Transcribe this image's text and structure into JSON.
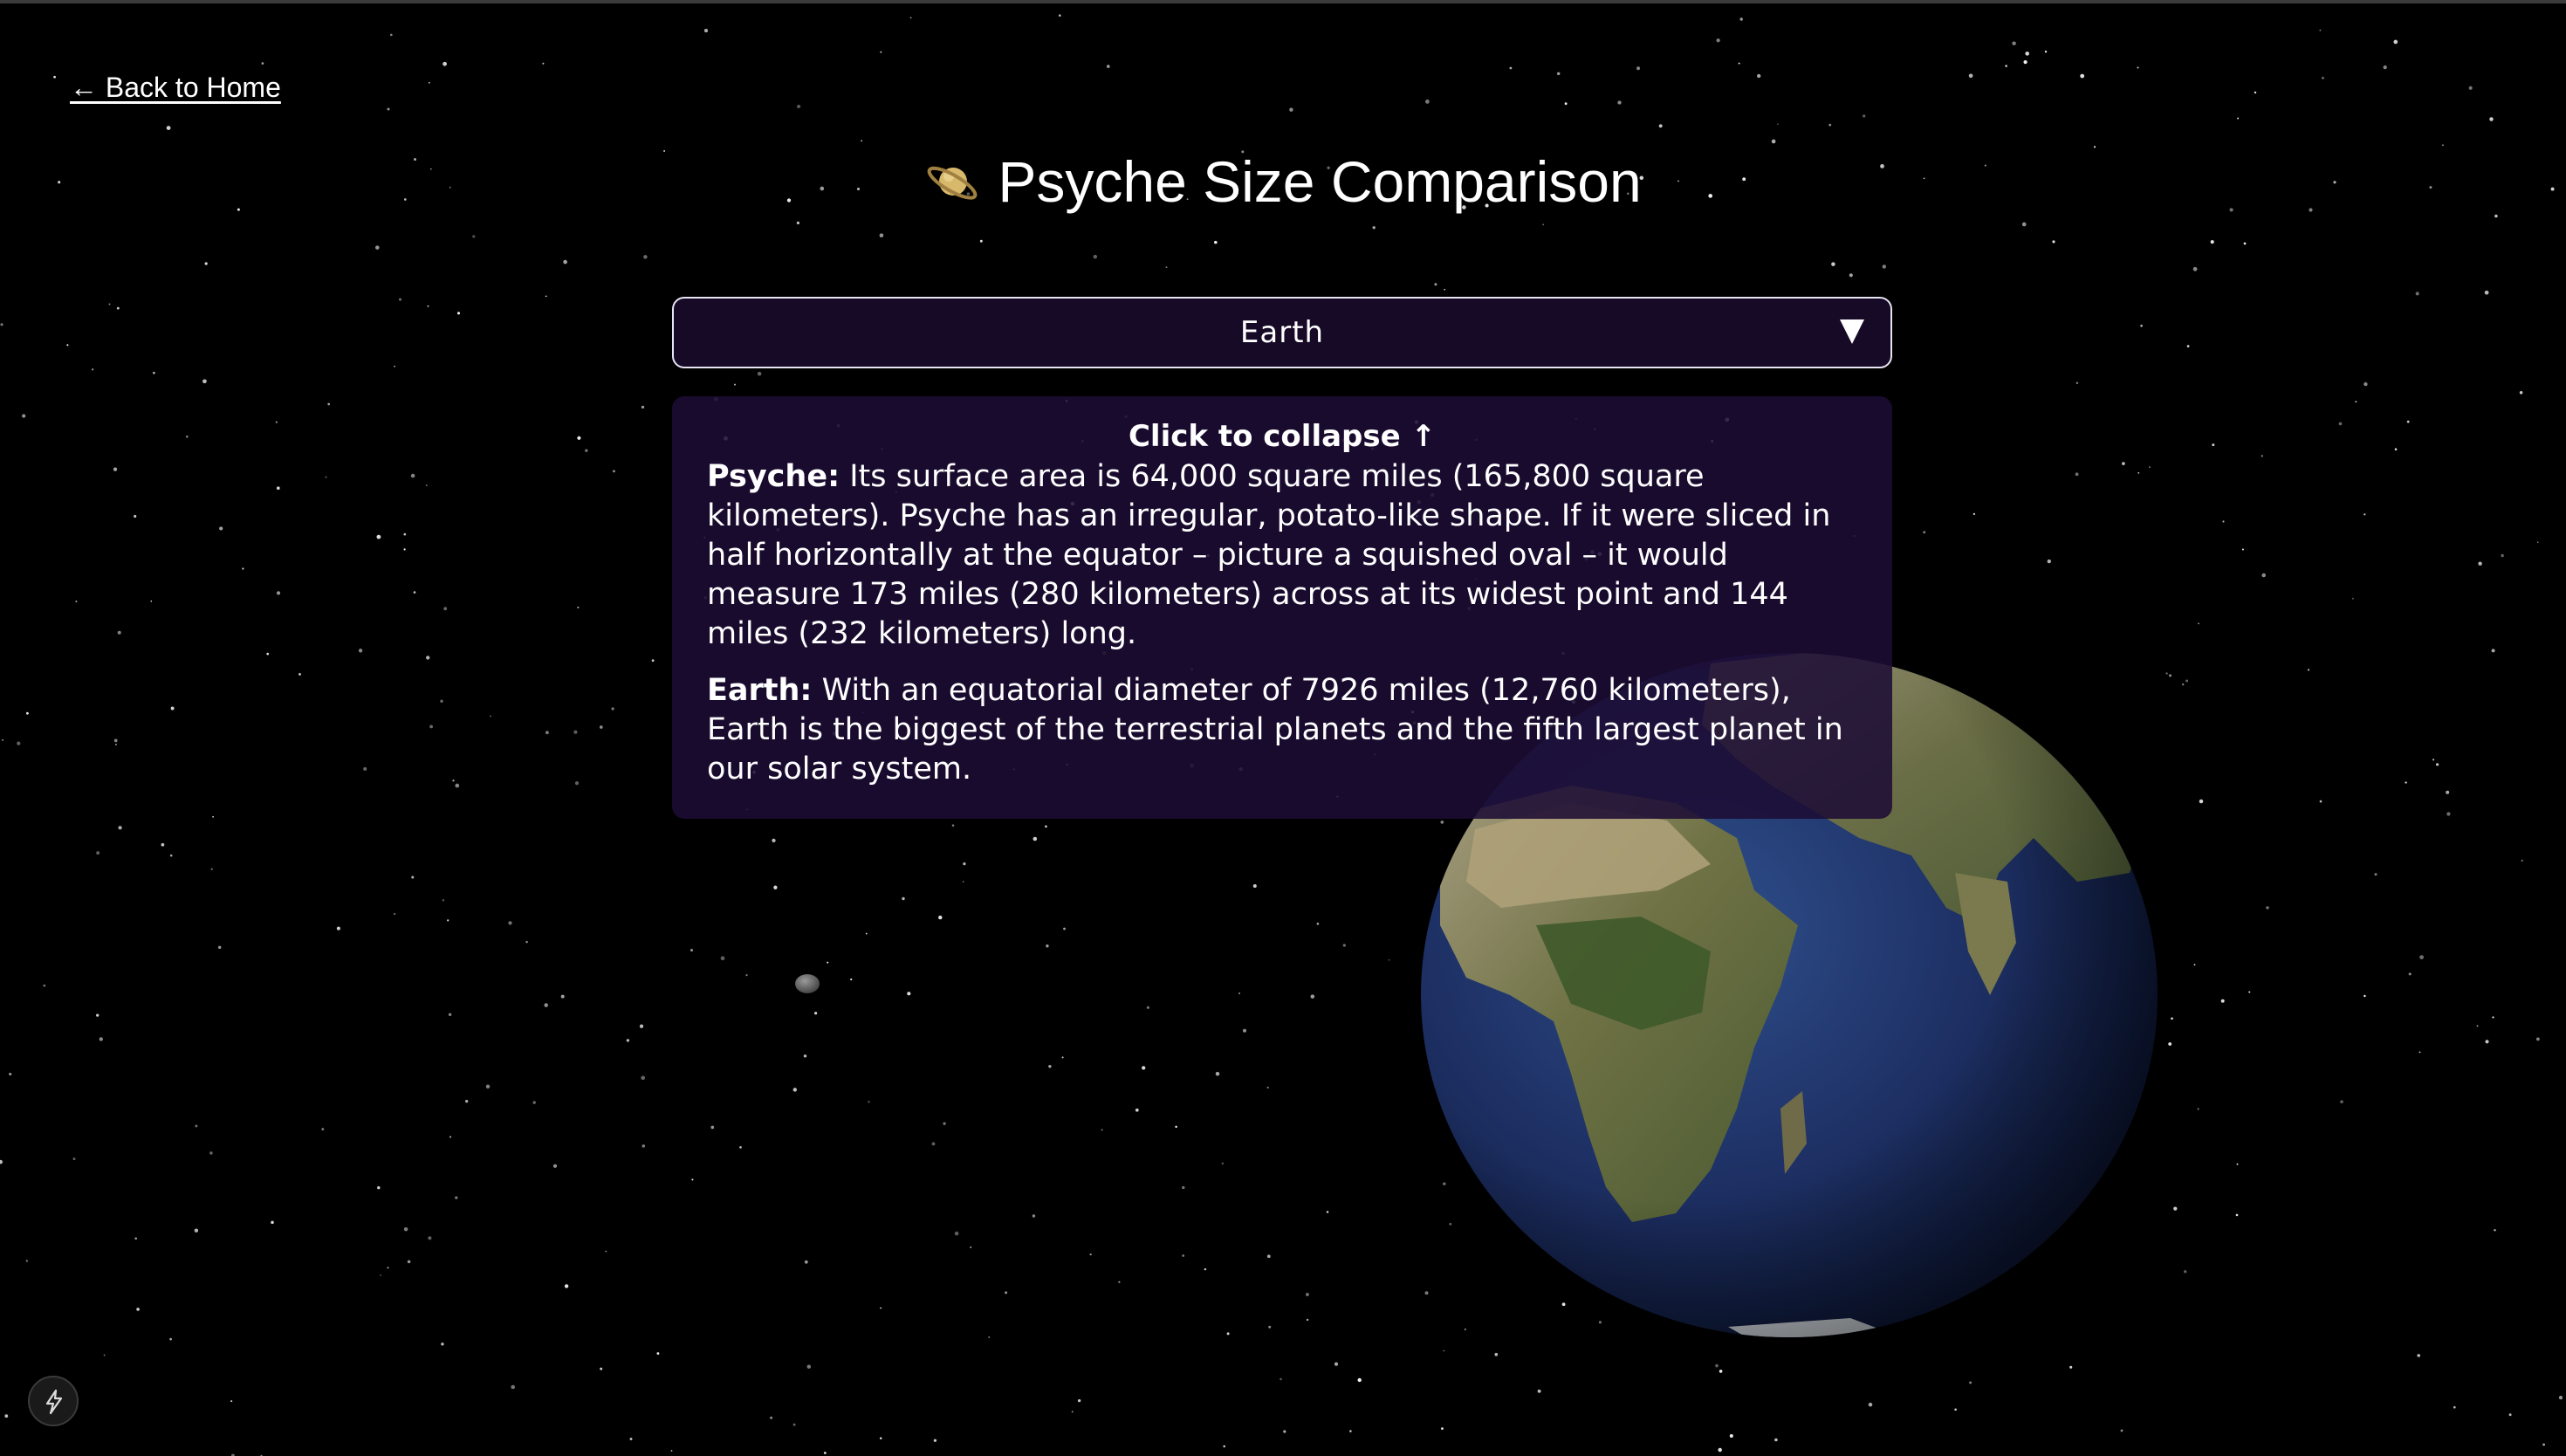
{
  "nav": {
    "back_label": "← Back to Home"
  },
  "header": {
    "icon": "ringed-planet-icon",
    "title": "Psyche Size Comparison"
  },
  "selector": {
    "selected_value": "Earth",
    "icon": "triangle-down-icon"
  },
  "info_panel": {
    "collapse_label": "Click to collapse ↑",
    "psyche": {
      "label": "Psyche:",
      "text": " Its surface area is 64,000 square miles (165,800 square kilometers). Psyche has an irregular, potato-like shape. If it were sliced in half horizontally at the equator – picture a squished oval – it would measure 173 miles (280 kilometers) across at its widest point and 144 miles (232 kilometers) long."
    },
    "earth": {
      "label": "Earth:",
      "text": " With an equatorial diameter of 7926 miles (12,760 kilometers), Earth is the biggest of the terrestrial planets and the fifth largest planet in our solar system."
    }
  },
  "scene": {
    "objects": [
      "Psyche",
      "Earth"
    ],
    "background": "#000000"
  },
  "corner_button": {
    "icon": "lightning-bolt-icon"
  }
}
